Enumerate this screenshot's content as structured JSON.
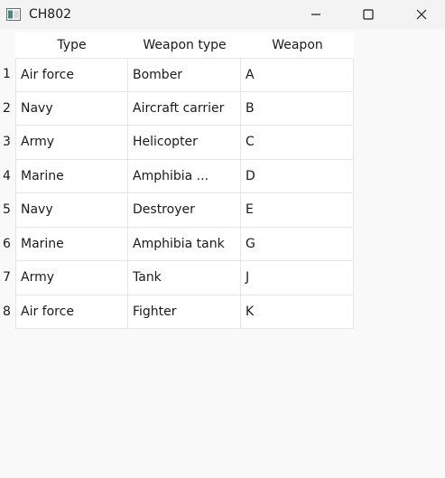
{
  "window": {
    "title": "CH802",
    "icon": "app-window-icon",
    "controls": [
      "minimize-icon",
      "maximize-icon",
      "close-icon"
    ]
  },
  "table": {
    "headers": [
      "Type",
      "Weapon type",
      "Weapon"
    ],
    "rows": [
      {
        "num": "1",
        "type": "Air force",
        "weapon_type": "Bomber",
        "weapon": "A"
      },
      {
        "num": "2",
        "type": "Navy",
        "weapon_type": "Aircraft carrier",
        "weapon": "B"
      },
      {
        "num": "3",
        "type": "Army",
        "weapon_type": "Helicopter",
        "weapon": "C"
      },
      {
        "num": "4",
        "type": "Marine",
        "weapon_type": "Amphibia ...",
        "weapon": "D"
      },
      {
        "num": "5",
        "type": "Navy",
        "weapon_type": "Destroyer",
        "weapon": "E"
      },
      {
        "num": "6",
        "type": "Marine",
        "weapon_type": "Amphibia tank",
        "weapon": "G"
      },
      {
        "num": "7",
        "type": "Army",
        "weapon_type": "Tank",
        "weapon": "J"
      },
      {
        "num": "8",
        "type": "Air force",
        "weapon_type": "Fighter",
        "weapon": "K"
      }
    ]
  }
}
